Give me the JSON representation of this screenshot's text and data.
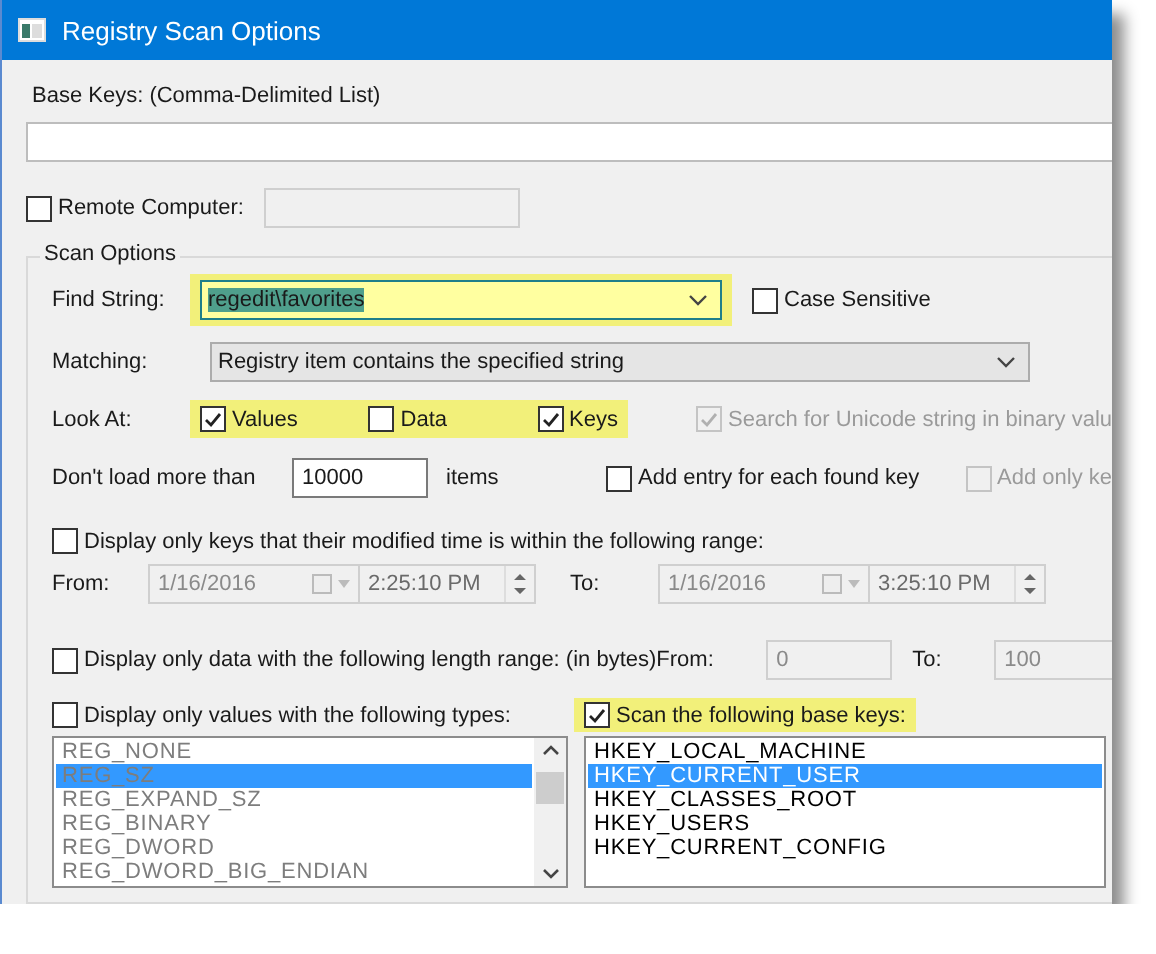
{
  "window": {
    "title": "Registry Scan Options"
  },
  "base_keys": {
    "label": "Base Keys:  (Comma-Delimited List)"
  },
  "remote_computer": {
    "label": "Remote Computer:",
    "checked": false
  },
  "scan_options": {
    "title": "Scan Options",
    "find_string": {
      "label": "Find String:",
      "value": "regedit\\favorites",
      "highlighted": true
    },
    "case_sensitive": {
      "label": "Case Sensitive",
      "checked": false
    },
    "matching": {
      "label": "Matching:",
      "value": "Registry item contains the specified string"
    },
    "look_at": {
      "label": "Look At:",
      "highlighted": true,
      "options": [
        {
          "label": "Values",
          "checked": true
        },
        {
          "label": "Data",
          "checked": false
        },
        {
          "label": "Keys",
          "checked": true
        }
      ]
    },
    "unicode_search": {
      "label": "Search for Unicode string in binary valu",
      "checked": true,
      "disabled": true
    },
    "max_items": {
      "label": "Don't load more than",
      "value": "10000",
      "unit": "items"
    },
    "add_entry": {
      "label": "Add entry for each found key",
      "checked": false
    },
    "add_only": {
      "label": "Add only ke",
      "checked": false,
      "disabled": true
    },
    "time_range": {
      "label": "Display only keys that their modified time is within the following range:",
      "checked": false,
      "from_label": "From:",
      "from_date": "1/16/2016",
      "from_time": "2:25:10 PM",
      "to_label": "To:",
      "to_date": "1/16/2016",
      "to_time": "3:25:10 PM"
    },
    "length_range": {
      "label": "Display only data with the following length range: (in bytes)",
      "checked": false,
      "from_label": "From:",
      "from_value": "0",
      "to_label": "To:",
      "to_value": "100"
    },
    "value_types": {
      "label": "Display only values with the following types:",
      "checked": false,
      "disabled": true,
      "items": [
        {
          "label": "REG_NONE",
          "selected": false
        },
        {
          "label": "REG_SZ",
          "selected": true
        },
        {
          "label": "REG_EXPAND_SZ",
          "selected": false
        },
        {
          "label": "REG_BINARY",
          "selected": false
        },
        {
          "label": "REG_DWORD",
          "selected": false
        },
        {
          "label": "REG_DWORD_BIG_ENDIAN",
          "selected": false
        }
      ]
    },
    "base_key_scan": {
      "label": "Scan the following base keys:",
      "checked": true,
      "highlighted": true,
      "disabled": false,
      "items": [
        {
          "label": "HKEY_LOCAL_MACHINE",
          "selected": false
        },
        {
          "label": "HKEY_CURRENT_USER",
          "selected": true
        },
        {
          "label": "HKEY_CLASSES_ROOT",
          "selected": false
        },
        {
          "label": "HKEY_USERS",
          "selected": false
        },
        {
          "label": "HKEY_CURRENT_CONFIG",
          "selected": false
        }
      ]
    }
  }
}
